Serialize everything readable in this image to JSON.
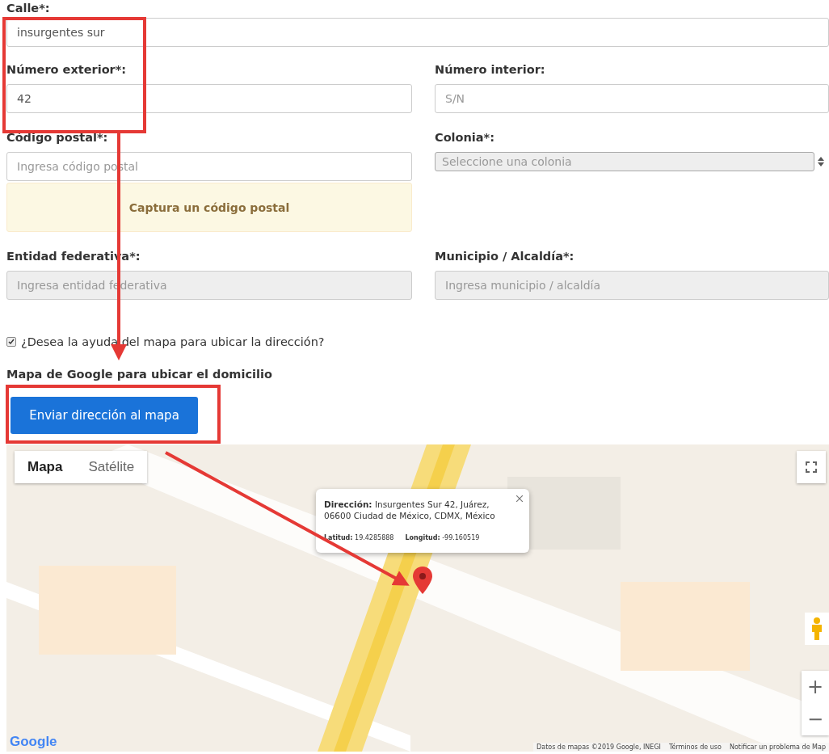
{
  "street_field": {
    "label": "Calle*:",
    "value": "insurgentes sur",
    "disabled": false,
    "kind": "text"
  },
  "field_rows": [
    [
      {
        "label": "Número exterior*:",
        "value": "42",
        "disabled": false,
        "kind": "text"
      },
      {
        "label": "Número interior:",
        "placeholder": "S/N",
        "disabled": false,
        "kind": "text"
      }
    ],
    [
      {
        "label": "Código postal*:",
        "placeholder": "Ingresa código postal",
        "disabled": false,
        "kind": "text",
        "alert": "Captura un código postal"
      },
      {
        "label": "Colonia*:",
        "placeholder": "Seleccione una colonia",
        "disabled": true,
        "kind": "select"
      }
    ],
    [
      {
        "label": "Entidad federativa*:",
        "placeholder": "Ingresa entidad federativa",
        "disabled": true,
        "kind": "text"
      },
      {
        "label": "Municipio / Alcaldía*:",
        "placeholder": "Ingresa municipio / alcaldía",
        "disabled": true,
        "kind": "text"
      }
    ]
  ],
  "map_checkbox": {
    "label": "¿Desea la ayuda del mapa para ubicar la dirección?",
    "checked": true
  },
  "map_heading": "Mapa de Google para ubicar el domicilio",
  "send_button": "Enviar dirección al mapa",
  "map": {
    "type_tabs": [
      {
        "label": "Mapa",
        "selected": true
      },
      {
        "label": "Satélite",
        "selected": false
      }
    ],
    "info_window": {
      "address": "**Dirección:** Insurgentes Sur 42, Juárez, 06600 Ciudad de México, CDMX, México",
      "latitude": "**Latitud:** 19.4285888",
      "longitude": "**Longitud:** -99.160519"
    },
    "zoom_in": "+",
    "zoom_out": "−",
    "logo": "Google",
    "footer": [
      "Datos de mapas ©2019 Google, INEGI",
      "Términos de uso",
      "Notificar un problema de Map"
    ]
  }
}
